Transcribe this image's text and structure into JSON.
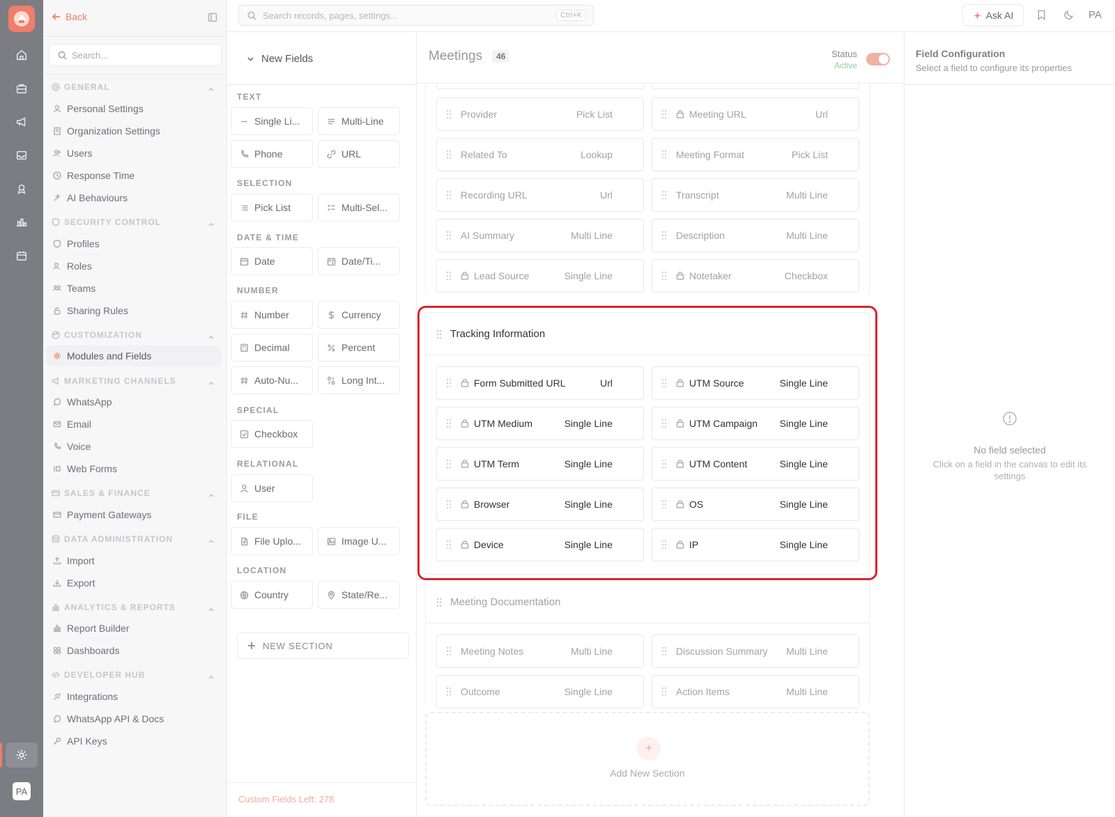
{
  "app": {
    "logo_icon": "brand-logo-icon",
    "user_initials": "PA"
  },
  "rail": {
    "icons": [
      "home-icon",
      "briefcase-icon",
      "megaphone-icon",
      "inbox-icon",
      "ribbon-icon",
      "bar-chart-icon",
      "calendar-icon"
    ],
    "settings_icon": "gear-icon"
  },
  "sidebar": {
    "back_label": "Back",
    "search_placeholder": "Search...",
    "groups": [
      {
        "label": "GENERAL",
        "items": [
          "Personal Settings",
          "Organization Settings",
          "Users",
          "Response Time",
          "AI Behaviours"
        ]
      },
      {
        "label": "SECURITY CONTROL",
        "items": [
          "Profiles",
          "Roles",
          "Teams",
          "Sharing Rules"
        ]
      },
      {
        "label": "CUSTOMIZATION",
        "items": [
          "Modules and Fields"
        ]
      },
      {
        "label": "MARKETING CHANNELS",
        "items": [
          "WhatsApp",
          "Email",
          "Voice",
          "Web Forms"
        ]
      },
      {
        "label": "SALES & FINANCE",
        "items": [
          "Payment Gateways"
        ]
      },
      {
        "label": "DATA ADMINISTRATION",
        "items": [
          "Import",
          "Export"
        ]
      },
      {
        "label": "ANALYTICS & REPORTS",
        "items": [
          "Report Builder",
          "Dashboards"
        ]
      },
      {
        "label": "DEVELOPER HUB",
        "items": [
          "Integrations",
          "WhatsApp API & Docs",
          "API Keys"
        ]
      }
    ],
    "active_item": "Modules and Fields"
  },
  "topbar": {
    "search_placeholder": "Search records, pages, settings...",
    "shortcut": "Ctrl+K",
    "ask_ai_label": "Ask AI",
    "user_initials": "PA"
  },
  "palette": {
    "header": "New Fields",
    "groups": [
      {
        "label": "TEXT",
        "fields": [
          "Single Li...",
          "Multi-Line",
          "Phone",
          "URL"
        ]
      },
      {
        "label": "SELECTION",
        "fields": [
          "Pick List",
          "Multi-Sel..."
        ]
      },
      {
        "label": "DATE & TIME",
        "fields": [
          "Date",
          "Date/Ti..."
        ]
      },
      {
        "label": "NUMBER",
        "fields": [
          "Number",
          "Currency",
          "Decimal",
          "Percent",
          "Auto-Nu...",
          "Long Int..."
        ]
      },
      {
        "label": "SPECIAL",
        "fields": [
          "Checkbox"
        ]
      },
      {
        "label": "RELATIONAL",
        "fields": [
          "User"
        ]
      },
      {
        "label": "FILE",
        "fields": [
          "File Uplo...",
          "Image U..."
        ]
      },
      {
        "label": "LOCATION",
        "fields": [
          "Country",
          "State/Re..."
        ]
      }
    ],
    "new_section_label": "NEW SECTION",
    "footer": "Custom Fields Left: 278"
  },
  "canvas": {
    "module_name": "Meetings",
    "record_count": "46",
    "status_label": "Status",
    "status_value": "Active",
    "status_on": true,
    "upper_fields": [
      {
        "name": "Provider",
        "type": "Pick List",
        "locked": false
      },
      {
        "name": "Meeting URL",
        "type": "Url",
        "locked": true
      },
      {
        "name": "Related To",
        "type": "Lookup",
        "locked": false
      },
      {
        "name": "Meeting Format",
        "type": "Pick List",
        "locked": false
      },
      {
        "name": "Recording URL",
        "type": "Url",
        "locked": false
      },
      {
        "name": "Transcript",
        "type": "Multi Line",
        "locked": false
      },
      {
        "name": "AI Summary",
        "type": "Multi Line",
        "locked": false
      },
      {
        "name": "Description",
        "type": "Multi Line",
        "locked": false
      },
      {
        "name": "Lead Source",
        "type": "Single Line",
        "locked": true
      },
      {
        "name": "Notetaker",
        "type": "Checkbox",
        "locked": true
      }
    ],
    "tracking_section": {
      "title": "Tracking Information",
      "fields": [
        {
          "name": "Form Submitted URL",
          "type": "Url",
          "locked": true
        },
        {
          "name": "UTM Source",
          "type": "Single Line",
          "locked": true
        },
        {
          "name": "UTM Medium",
          "type": "Single Line",
          "locked": true
        },
        {
          "name": "UTM Campaign",
          "type": "Single Line",
          "locked": true
        },
        {
          "name": "UTM Term",
          "type": "Single Line",
          "locked": true
        },
        {
          "name": "UTM Content",
          "type": "Single Line",
          "locked": true
        },
        {
          "name": "Browser",
          "type": "Single Line",
          "locked": true
        },
        {
          "name": "OS",
          "type": "Single Line",
          "locked": true
        },
        {
          "name": "Device",
          "type": "Single Line",
          "locked": true
        },
        {
          "name": "IP",
          "type": "Single Line",
          "locked": true
        }
      ]
    },
    "documentation_section": {
      "title": "Meeting Documentation",
      "fields": [
        {
          "name": "Meeting Notes",
          "type": "Multi Line",
          "locked": false
        },
        {
          "name": "Discussion Summary",
          "type": "Multi Line",
          "locked": false
        },
        {
          "name": "Outcome",
          "type": "Single Line",
          "locked": false
        },
        {
          "name": "Action Items",
          "type": "Multi Line",
          "locked": false
        }
      ]
    },
    "add_section_label": "Add New Section",
    "add_section_symbol": "+",
    "highlight_color": "#d8252e"
  },
  "config": {
    "title": "Field Configuration",
    "subtitle": "Select a field to configure its properties",
    "empty_title": "No field selected",
    "empty_hint": "Click on a field in the canvas to edit its settings"
  },
  "colors": {
    "accent": "#ef7e6a",
    "active_green": "#8bcf9b"
  }
}
